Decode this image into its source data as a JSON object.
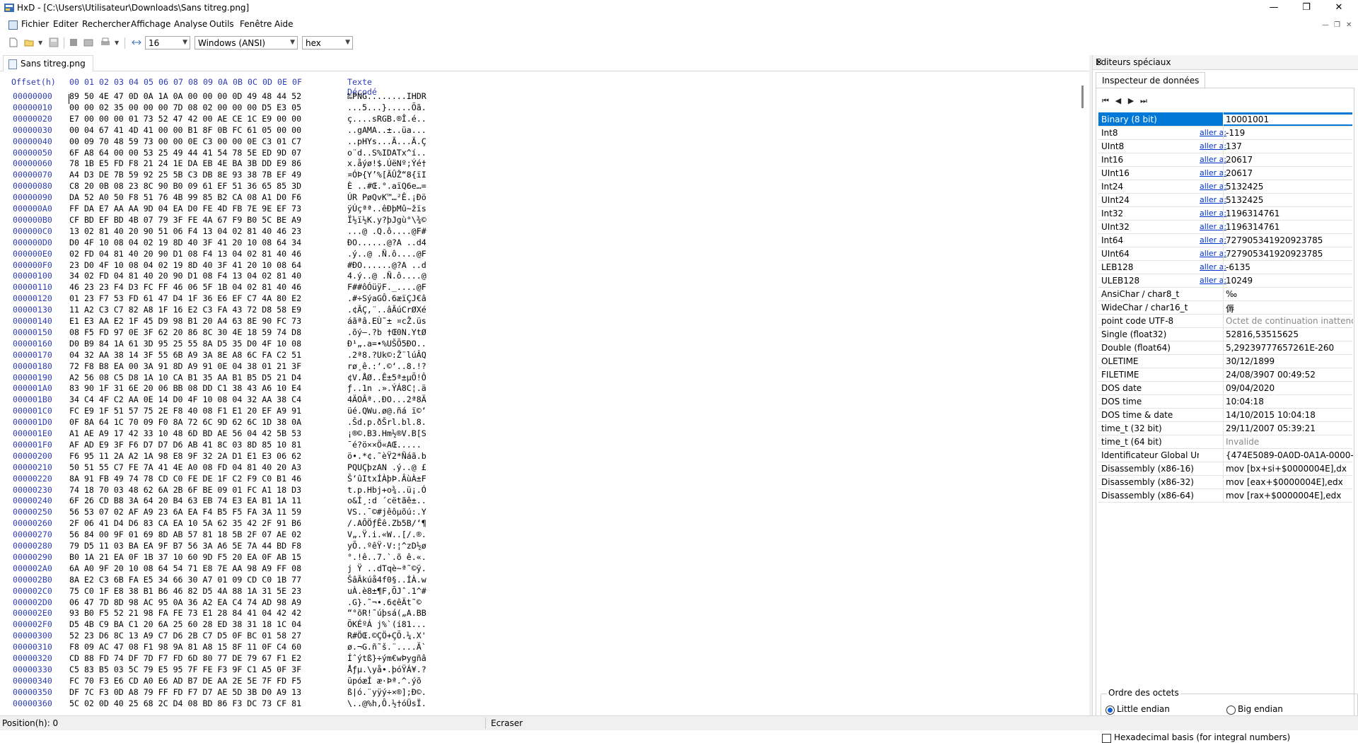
{
  "window": {
    "title": "HxD - [C:\\Users\\Utilisateur\\Downloads\\Sans titreg.png]",
    "minimize": "—",
    "maximize": "❐",
    "close": "✕"
  },
  "menu": [
    "Fichier",
    "Editer",
    "Rechercher",
    "Affichage",
    "Analyse",
    "Outils",
    "Fenêtre",
    "Aide"
  ],
  "toolbar": {
    "bytes_per_row": "16",
    "charset": "Windows (ANSI)",
    "display": "hex"
  },
  "file_tab": "Sans titreg.png",
  "hex": {
    "header_offset": "Offset(h)",
    "header_cols": [
      "00",
      "01",
      "02",
      "03",
      "04",
      "05",
      "06",
      "07",
      "08",
      "09",
      "0A",
      "0B",
      "0C",
      "0D",
      "0E",
      "0F"
    ],
    "header_text": "Texte Décodé",
    "rows": [
      {
        "off": "00000000",
        "b": "89 50 4E 47 0D 0A 1A 0A 00 00 00 0D 49 48 44 52",
        "t": "‰PNG........IHDR"
      },
      {
        "off": "00000010",
        "b": "00 00 02 35 00 00 00 7D 08 02 00 00 00 D5 E3 05",
        "t": "...5...}.....Õã."
      },
      {
        "off": "00000020",
        "b": "E7 00 00 00 01 73 52 47 42 00 AE CE 1C E9 00 00",
        "t": "ç....sRGB.®Î.é.."
      },
      {
        "off": "00000030",
        "b": "00 04 67 41 4D 41 00 00 B1 8F 0B FC 61 05 00 00",
        "t": "..gAMA..±..üa..."
      },
      {
        "off": "00000040",
        "b": "00 09 70 48 59 73 00 00 0E C3 00 00 0E C3 01 C7",
        "t": "..pHYs...Ã...Ã.Ç"
      },
      {
        "off": "00000050",
        "b": "6F A8 64 00 00 53 25 49 44 41 54 78 5E ED 9D 07",
        "t": "o¨d..S%IDATx^í.."
      },
      {
        "off": "00000060",
        "b": "78 1B E5 FD F8 21 24 1E DA EB 4E BA 3B DD E9 86",
        "t": "x.åýø!$.ÚëNº;Ýé†"
      },
      {
        "off": "00000070",
        "b": "A4 D3 DE 7B 59 92 25 5B C3 DB 8E 93 38 7B EF 49",
        "t": "¤ÓÞ{Y’%[ÃÛŽ“8{ïI"
      },
      {
        "off": "00000080",
        "b": "C8 20 0B 08 23 8C 90 B0 09 61 EF 51 36 65 85 3D",
        "t": "È ..#Œ.°.aïQ6e…="
      },
      {
        "off": "00000090",
        "b": "DA 52 A0 50 F8 51 76 4B 99 85 B2 CA 08 A1 D0 F6",
        "t": "ÚR PøQvK™…²Ê.¡Ðö"
      },
      {
        "off": "000000A0",
        "b": "FF DA E7 AA AA 9D 04 EA D0 FE 4D FB 7E 9E EF 73",
        "t": "ÿÚçªª..êÐþMû~žïs"
      },
      {
        "off": "000000B0",
        "b": "CF BD EF BD 4B 07 79 3F FE 4A 67 F9 B0 5C BE A9",
        "t": "Ï½ï½K.y?þJgù°\\¾©"
      },
      {
        "off": "000000C0",
        "b": "13 02 81 40 20 90 51 06 F4 13 04 02 81 40 46 23",
        "t": "...@ .Q.ô....@F#"
      },
      {
        "off": "000000D0",
        "b": "D0 4F 10 08 04 02 19 8D 40 3F 41 20 10 08 64 34",
        "t": "ÐO......@?A ..d4"
      },
      {
        "off": "000000E0",
        "b": "02 FD 04 81 40 20 90 D1 08 F4 13 04 02 81 40 46",
        "t": ".ý..@ .Ñ.ô....@F"
      },
      {
        "off": "000000F0",
        "b": "23 D0 4F 10 08 04 02 19 8D 40 3F 41 20 10 08 64",
        "t": "#ÐO......@?A ..d"
      },
      {
        "off": "00000100",
        "b": "34 02 FD 04 81 40 20 90 D1 08 F4 13 04 02 81 40",
        "t": "4.ý..@ .Ñ.ô....@"
      },
      {
        "off": "00000110",
        "b": "46 23 23 F4 D3 FC FF 46 06 5F 1B 04 02 81 40 46",
        "t": "F##ôÓüÿF._....@F"
      },
      {
        "off": "00000120",
        "b": "01 23 F7 53 FD 61 47 D4 1F 36 E6 EF C7 4A 80 E2",
        "t": ".#÷SýaGÔ.6æïÇJ€â"
      },
      {
        "off": "00000130",
        "b": "11 A2 C3 C7 82 A8 1F 16 E2 C3 FA 43 72 D8 58 E9",
        "t": ".¢ÃÇ‚¨..âÃúCrØXé"
      },
      {
        "off": "00000140",
        "b": "E1 E3 AA E2 1F 45 D9 98 B1 20 A4 63 8E 90 FC 73",
        "t": "áãªâ.EÙ˜± ¤cŽ.üs"
      },
      {
        "off": "00000150",
        "b": "08 F5 FD 97 0E 3F 62 20 86 8C 30 4E 18 59 74 D8",
        "t": ".õý—.?b †Œ0N.YtØ"
      },
      {
        "off": "00000160",
        "b": "D0 B9 84 1A 61 3D 95 25 55 8A D5 35 D0 4F 10 08",
        "t": "Ð¹„.a=•%UŠÕ5ÐO.."
      },
      {
        "off": "00000170",
        "b": "04 32 AA 38 14 3F 55 6B A9 3A 8E A8 6C FA C2 51",
        "t": ".2ª8.?Uk©:Ž¨lúÂQ"
      },
      {
        "off": "00000180",
        "b": "72 F8 B8 EA 00 3A 91 8D A9 91 0E 04 38 01 21 3F",
        "t": "rø¸ê.:‘.©‘..8.!?"
      },
      {
        "off": "00000190",
        "b": "A2 56 08 C5 D8 1A 10 CA B1 35 AA B1 B5 D5 21 D4",
        "t": "¢V.ÅØ..Ê±5ª±µÕ!Ô"
      },
      {
        "off": "000001A0",
        "b": "83 90 1F 31 6E 20 06 BB 08 DD C1 38 43 A6 10 E4",
        "t": "ƒ..1n .».ÝÁ8C¦.ä"
      },
      {
        "off": "000001B0",
        "b": "34 C4 4F C2 AA 0E 14 D0 4F 10 08 04 32 AA 38 C4",
        "t": "4ÄOÂª..ÐO...2ª8Ä"
      },
      {
        "off": "000001C0",
        "b": "FC E9 1F 51 57 75 2E F8 40 08 F1 E1 20 EF A9 91",
        "t": "üé.QWu.ø@.ñá ï©‘"
      },
      {
        "off": "000001D0",
        "b": "0F 8A 64 1C 70 09 F0 8A 72 6C 9D 62 6C 1D 38 0A",
        "t": ".Šd.p.ðŠrl.bl.8."
      },
      {
        "off": "000001E0",
        "b": "A1 AE A9 17 42 33 10 48 6D BD AE 56 04 42 5B 53",
        "t": "¡®©.B3.Hm½®V.B[S"
      },
      {
        "off": "000001F0",
        "b": "AF AD E9 3F F6 D7 D7 D6 AB 41 8C 03 8D 85 10 81",
        "t": "¯­é?ö××Ö«AŒ....."
      },
      {
        "off": "00000200",
        "b": "F6 95 11 2A A2 1A 98 E8 9F 32 2A D1 E1 E3 06 62",
        "t": "ö•.*¢.˜èŸ2*Ñáã.b"
      },
      {
        "off": "00000210",
        "b": "50 51 55 C7 FE 7A 41 4E A0 08 FD 04 81 40 20 A3",
        "t": "PQUÇþzAN .ý..@ £"
      },
      {
        "off": "00000220",
        "b": "8A 91 FB 49 74 78 CD C0 FE DE 1F C2 F9 C0 B1 46",
        "t": "Š‘ûItxÍÀþÞ.ÂùÀ±F"
      },
      {
        "off": "00000230",
        "b": "74 18 70 03 48 62 6A 2B 6F BE 09 01 FC A1 18 D3",
        "t": "t.p.Hbj+o¾..ü¡.Ó"
      },
      {
        "off": "00000240",
        "b": "6F 26 CD B8 3A 64 20 B4 63 EB 74 E3 EA B1 1A 11",
        "t": "o&Í¸:d ´cëtãê±.."
      },
      {
        "off": "00000250",
        "b": "56 53 07 02 AF A9 23 6A EA F4 B5 F5 FA 3A 11 59",
        "t": "VS..¯©#jêôµõú:.Y"
      },
      {
        "off": "00000260",
        "b": "2F 06 41 D4 D6 83 CA EA 10 5A 62 35 42 2F 91 B6",
        "t": "/.AÔÖƒÊê.Zb5B/‘¶"
      },
      {
        "off": "00000270",
        "b": "56 84 00 9F 01 69 8D AB 57 81 18 5B 2F 07 AE 02",
        "t": "V„.Ÿ.i.«W..[/.®."
      },
      {
        "off": "00000280",
        "b": "79 D5 11 03 BA EA 9F B7 56 3A A6 5E 7A 44 BD F8",
        "t": "yÕ..ºêŸ·V:¦^zD½ø"
      },
      {
        "off": "00000290",
        "b": "B0 1A 21 EA 0F 1B 37 10 60 9D F5 20 EA 0F AB 15",
        "t": "°.!ê..7.`.õ ê.«."
      },
      {
        "off": "000002A0",
        "b": "6A A0 9F 20 10 08 64 54 71 E8 7E AA 98 A9 FF 08",
        "t": "j Ÿ ..dTqè~ª˜©ÿ."
      },
      {
        "off": "000002B0",
        "b": "8A E2 C3 6B FA E5 34 66 30 A7 01 09 CD C0 1B 77",
        "t": "ŠâÃkúå4f0§..ÍÀ.w"
      },
      {
        "off": "000002C0",
        "b": "75 C0 1F E8 38 B1 B6 46 82 D5 4A 88 1A 31 5E 23",
        "t": "uÀ.è8±¶F‚ÕJˆ.1^#"
      },
      {
        "off": "000002D0",
        "b": "06 47 7D 8D 98 AC 95 0A 36 A2 EA C4 74 AD 98 A9",
        "t": ".G}.˜¬•.6¢êÄt­˜©"
      },
      {
        "off": "000002E0",
        "b": "93 B0 F5 52 21 98 FA FE 73 E1 28 84 41 04 42 42",
        "t": "“°õR!˜úþsá(„A.BB"
      },
      {
        "off": "000002F0",
        "b": "D5 4B C9 BA C1 20 6A 25 60 28 ED 38 31 18 1C 04",
        "t": "ÕKÉºÁ j%`(í81..."
      },
      {
        "off": "00000300",
        "b": "52 23 D6 8C 13 A9 C7 D6 2B C7 D5 0F BC 01 58 27",
        "t": "R#ÖŒ.©ÇÖ+ÇÕ.¼.X'"
      },
      {
        "off": "00000310",
        "b": "F8 09 AC 47 08 F1 98 9A 81 A8 15 8F 11 0F C4 60",
        "t": "ø.¬G.ñ˜š.¨....Ä`"
      },
      {
        "off": "00000320",
        "b": "CD 88 FD 74 DF 7D F7 FD 6D 80 77 DE 79 67 F1 E2",
        "t": "Íˆýtß}÷ým€wÞygñâ"
      },
      {
        "off": "00000330",
        "b": "C5 83 B5 03 5C 79 E5 95 7F FE F3 9F C1 A5 0F 3F",
        "t": "Åƒµ.\\yå•.þóŸÁ¥.?"
      },
      {
        "off": "00000340",
        "b": "FC 70 F3 E6 CD A0 E6 AD B7 DE AA 2E 5E 7F FD F5",
        "t": "üpóæÍ æ­·Þª.^.ýõ"
      },
      {
        "off": "00000350",
        "b": "DF 7C F3 0D A8 79 FF FD F7 D7 AE 5D 3B D0 A9 13",
        "t": "ß|ó.¨yÿý÷×®];Ð©."
      },
      {
        "off": "00000360",
        "b": "5C 02 0D 40 25 68 2C D4 08 BD 86 F3 DC 73 CF 81",
        "t": "\\..@%h,Ô.½†óÜsÏ."
      }
    ]
  },
  "panel": {
    "title": "Editeurs spéciaux",
    "close": "✕",
    "tab": "Inspecteur de données",
    "nav": [
      "⏮",
      "◀",
      "▶",
      "⏭"
    ],
    "goto": "aller a:",
    "rows": [
      {
        "name": "Binary (8 bit)",
        "link": "",
        "value": "10001001"
      },
      {
        "name": "Int8",
        "link": "aller a:",
        "value": "-119"
      },
      {
        "name": "UInt8",
        "link": "aller a:",
        "value": "137"
      },
      {
        "name": "Int16",
        "link": "aller a:",
        "value": "20617"
      },
      {
        "name": "UInt16",
        "link": "aller a:",
        "value": "20617"
      },
      {
        "name": "Int24",
        "link": "aller a:",
        "value": "5132425"
      },
      {
        "name": "UInt24",
        "link": "aller a:",
        "value": "5132425"
      },
      {
        "name": "Int32",
        "link": "aller a:",
        "value": "1196314761"
      },
      {
        "name": "UInt32",
        "link": "aller a:",
        "value": "1196314761"
      },
      {
        "name": "Int64",
        "link": "aller a:",
        "value": "727905341920923785"
      },
      {
        "name": "UInt64",
        "link": "aller a:",
        "value": "727905341920923785"
      },
      {
        "name": "LEB128",
        "link": "aller a:",
        "value": "-6135"
      },
      {
        "name": "ULEB128",
        "link": "aller a:",
        "value": "10249"
      },
      {
        "name": "AnsiChar / char8_t",
        "link": "",
        "value": "‰"
      },
      {
        "name": "WideChar / char16_t",
        "link": "",
        "value": "傉"
      },
      {
        "name": "point code UTF-8",
        "link": "",
        "value": "Octet de continuation inattendu"
      },
      {
        "name": "Single (float32)",
        "link": "",
        "value": "52816,53515625"
      },
      {
        "name": "Double (float64)",
        "link": "",
        "value": "5,29239777657261E-260"
      },
      {
        "name": "OLETIME",
        "link": "",
        "value": "30/12/1899"
      },
      {
        "name": "FILETIME",
        "link": "",
        "value": "24/08/3907 00:49:52"
      },
      {
        "name": "DOS date",
        "link": "",
        "value": "09/04/2020"
      },
      {
        "name": "DOS time",
        "link": "",
        "value": "10:04:18"
      },
      {
        "name": "DOS time & date",
        "link": "",
        "value": "14/10/2015 10:04:18"
      },
      {
        "name": "time_t (32 bit)",
        "link": "",
        "value": "29/11/2007 05:39:21"
      },
      {
        "name": "time_t (64 bit)",
        "link": "",
        "value": "Invalide"
      },
      {
        "name": "Identificateur Global Unique",
        "link": "",
        "value": "{474E5089-0A0D-0A1A-0000-000D"
      },
      {
        "name": "Disassembly (x86-16)",
        "link": "",
        "value": "mov [bx+si+$0000004E],dx"
      },
      {
        "name": "Disassembly (x86-32)",
        "link": "",
        "value": "mov [eax+$0000004E],edx"
      },
      {
        "name": "Disassembly (x86-64)",
        "link": "",
        "value": "mov [rax+$0000004E],edx"
      }
    ],
    "byte_order_label": "Ordre des octets",
    "little_endian": "Little endian",
    "big_endian": "Big endian",
    "hex_basis": "Hexadecimal basis (for integral numbers)"
  },
  "status": {
    "position": "Position(h): 0",
    "mode": "Ecraser"
  }
}
